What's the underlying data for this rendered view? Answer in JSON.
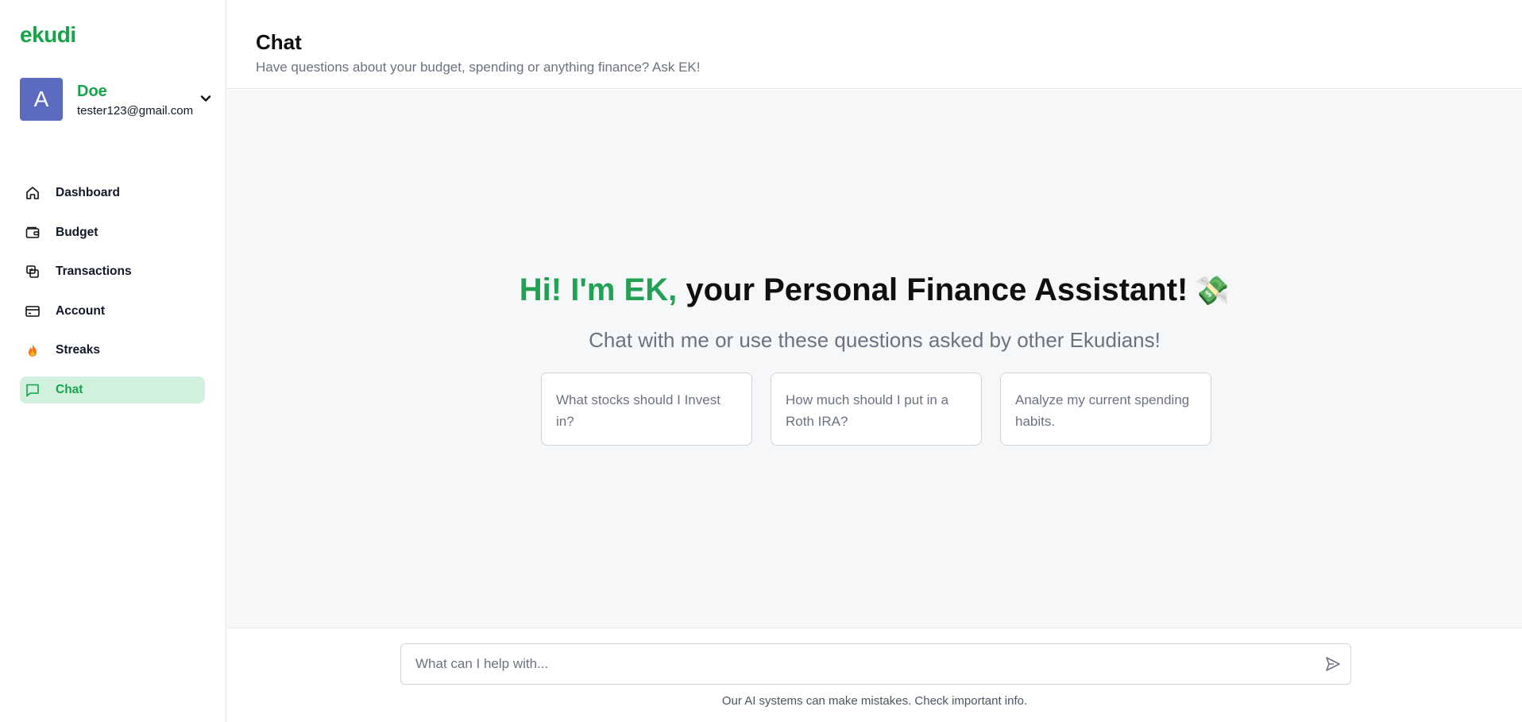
{
  "brand": {
    "name": "ekudi",
    "accent": "#16a34a"
  },
  "user": {
    "avatar_letter": "A",
    "name": "Doe",
    "email": "tester123@gmail.com",
    "avatar_color": "#5c6bc0"
  },
  "sidebar": {
    "items": [
      {
        "label": "Dashboard",
        "icon": "home-icon",
        "active": false
      },
      {
        "label": "Budget",
        "icon": "wallet-icon",
        "active": false
      },
      {
        "label": "Transactions",
        "icon": "transfer-icon",
        "active": false
      },
      {
        "label": "Account",
        "icon": "credit-card-icon",
        "active": false
      },
      {
        "label": "Streaks",
        "icon": "fire-icon",
        "active": false
      },
      {
        "label": "Chat",
        "icon": "chat-bubble-icon",
        "active": true
      }
    ]
  },
  "header": {
    "title": "Chat",
    "subtitle": "Have questions about your budget, spending or anything finance? Ask EK!"
  },
  "hero": {
    "greeting": "Hi! I'm EK,",
    "title_rest": " your Personal Finance Assistant!",
    "emoji": "💸",
    "subtitle": "Chat with me or use these questions asked by other Ekudians!"
  },
  "suggestions": [
    "What stocks should I Invest in?",
    "How much should I put in a Roth IRA?",
    "Analyze my current spending habits."
  ],
  "composer": {
    "placeholder": "What can I help with...",
    "value": "",
    "disclaimer": "Our AI systems can make mistakes. Check important info."
  }
}
